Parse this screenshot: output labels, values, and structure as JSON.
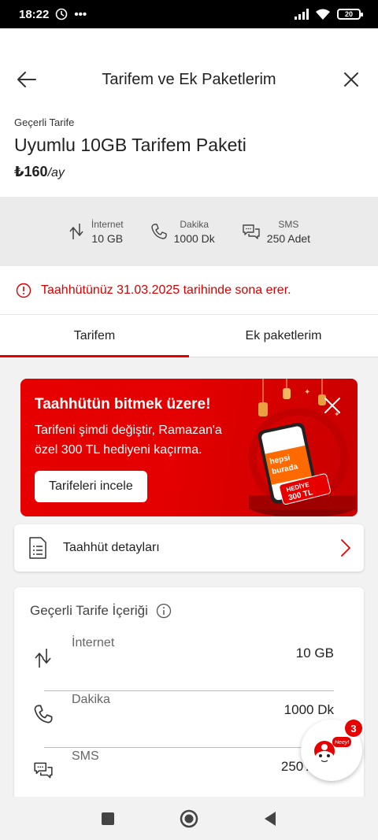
{
  "status_bar": {
    "time": "18:22",
    "dots": "•••",
    "battery": "20"
  },
  "header": {
    "title": "Tarifem ve Ek Paketlerim"
  },
  "tariff": {
    "label": "Geçerli Tarife",
    "name": "Uyumlu 10GB Tarifem Paketi",
    "price": "₺160",
    "period": "/ay"
  },
  "usage": [
    {
      "icon": "internet-arrows-icon",
      "label": "İnternet",
      "value": "10 GB"
    },
    {
      "icon": "phone-icon",
      "label": "Dakika",
      "value": "1000 Dk"
    },
    {
      "icon": "sms-icon",
      "label": "SMS",
      "value": "250 Adet"
    }
  ],
  "alert": {
    "text": "Taahhütünüz 31.03.2025 tarihinde sona erer."
  },
  "tabs": [
    {
      "label": "Tarifem",
      "active": true
    },
    {
      "label": "Ek paketlerim",
      "active": false
    }
  ],
  "promo": {
    "heading": "Taahhütün bitmek üzere!",
    "body": "Tarifeni şimdi değiştir, Ramazan'a özel 300 TL hediyeni kaçırma.",
    "button": "Tarifeleri incele",
    "art_text1": "hepsi",
    "art_text2": "burada",
    "art_text3": "HEDİYE",
    "art_text4": "300 TL"
  },
  "commitment": {
    "label": "Taahhüt detayları"
  },
  "content": {
    "title": "Geçerli Tarife İçeriği",
    "rows": [
      {
        "label": "İnternet",
        "value": "10 GB"
      },
      {
        "label": "Dakika",
        "value": "1000 Dk"
      },
      {
        "label": "SMS",
        "value": "250 Adet"
      }
    ]
  },
  "chatbot": {
    "badge": "3",
    "bubble": "Heey!"
  },
  "colors": {
    "brand_red": "#e60000",
    "alert_red": "#d40000",
    "usage_bg": "#ebebeb"
  }
}
